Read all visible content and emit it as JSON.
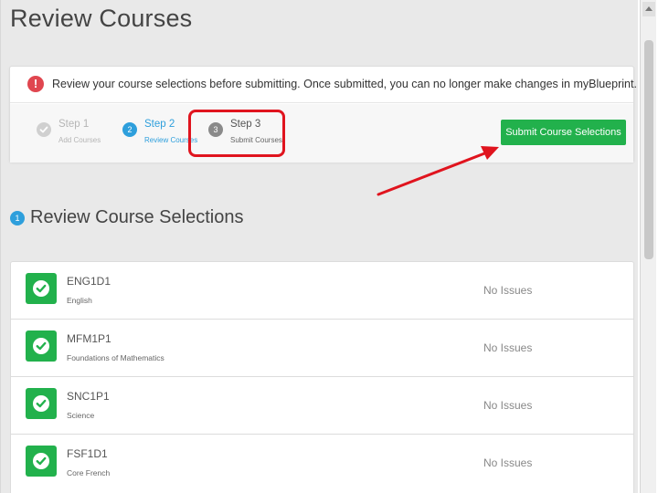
{
  "page": {
    "title": "Review Courses"
  },
  "alert": {
    "icon": "!",
    "message": "Review your course selections before submitting. Once submitted, you can no longer make changes in myBlueprint."
  },
  "steps": [
    {
      "title": "Step 1",
      "subtitle": "Add Courses",
      "icon": "check-icon",
      "state": "completed"
    },
    {
      "title": "Step 2",
      "subtitle": "Review Courses",
      "number": "2",
      "state": "current"
    },
    {
      "title": "Step 3",
      "subtitle": "Submit Courses",
      "number": "3",
      "state": "upcoming"
    }
  ],
  "submit_button": {
    "label": "Submit Course Selections"
  },
  "section": {
    "number": "1",
    "title": "Review Course Selections"
  },
  "courses": [
    {
      "code": "ENG1D1",
      "name": "English",
      "status": "No Issues"
    },
    {
      "code": "MFM1P1",
      "name": "Foundations of Mathematics",
      "status": "No Issues"
    },
    {
      "code": "SNC1P1",
      "name": "Science",
      "status": "No Issues"
    },
    {
      "code": "FSF1D1",
      "name": "Core French",
      "status": "No Issues"
    }
  ],
  "colors": {
    "accent_blue": "#2e9fdc",
    "success_green": "#22b14c",
    "alert_red": "#e0464f",
    "annotation_red": "#e0141e"
  }
}
